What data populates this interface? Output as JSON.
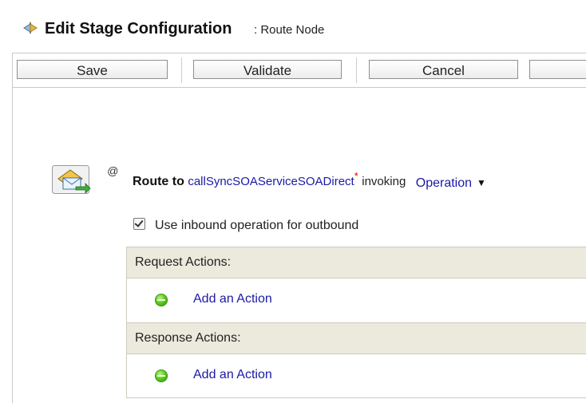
{
  "header": {
    "title": "Edit Stage Configuration",
    "subtitle": ": Route Node",
    "icon": "stage-config-icon"
  },
  "toolbar": {
    "save_label": "Save",
    "validate_label": "Validate",
    "cancel_label": "Cancel",
    "extra_label": ""
  },
  "route": {
    "icon": "route-envelope-icon",
    "at_symbol": "@",
    "route_to_label": "Route to",
    "service_name": "callSyncSOAServiceSOADirect",
    "required_marker": "*",
    "invoking_label": "invoking",
    "operation_label": "Operation",
    "caret": "▼"
  },
  "options": {
    "use_inbound_label": "Use inbound operation for outbound",
    "use_inbound_checked": true
  },
  "request": {
    "header": "Request Actions:",
    "add_action": "Add an Action"
  },
  "response": {
    "header": "Response Actions:",
    "add_action": "Add an Action"
  },
  "colors": {
    "link": "#1a1aa6",
    "section_bg": "#ece9dd",
    "required": "#dd0000",
    "status_green": "#5ac81e"
  }
}
